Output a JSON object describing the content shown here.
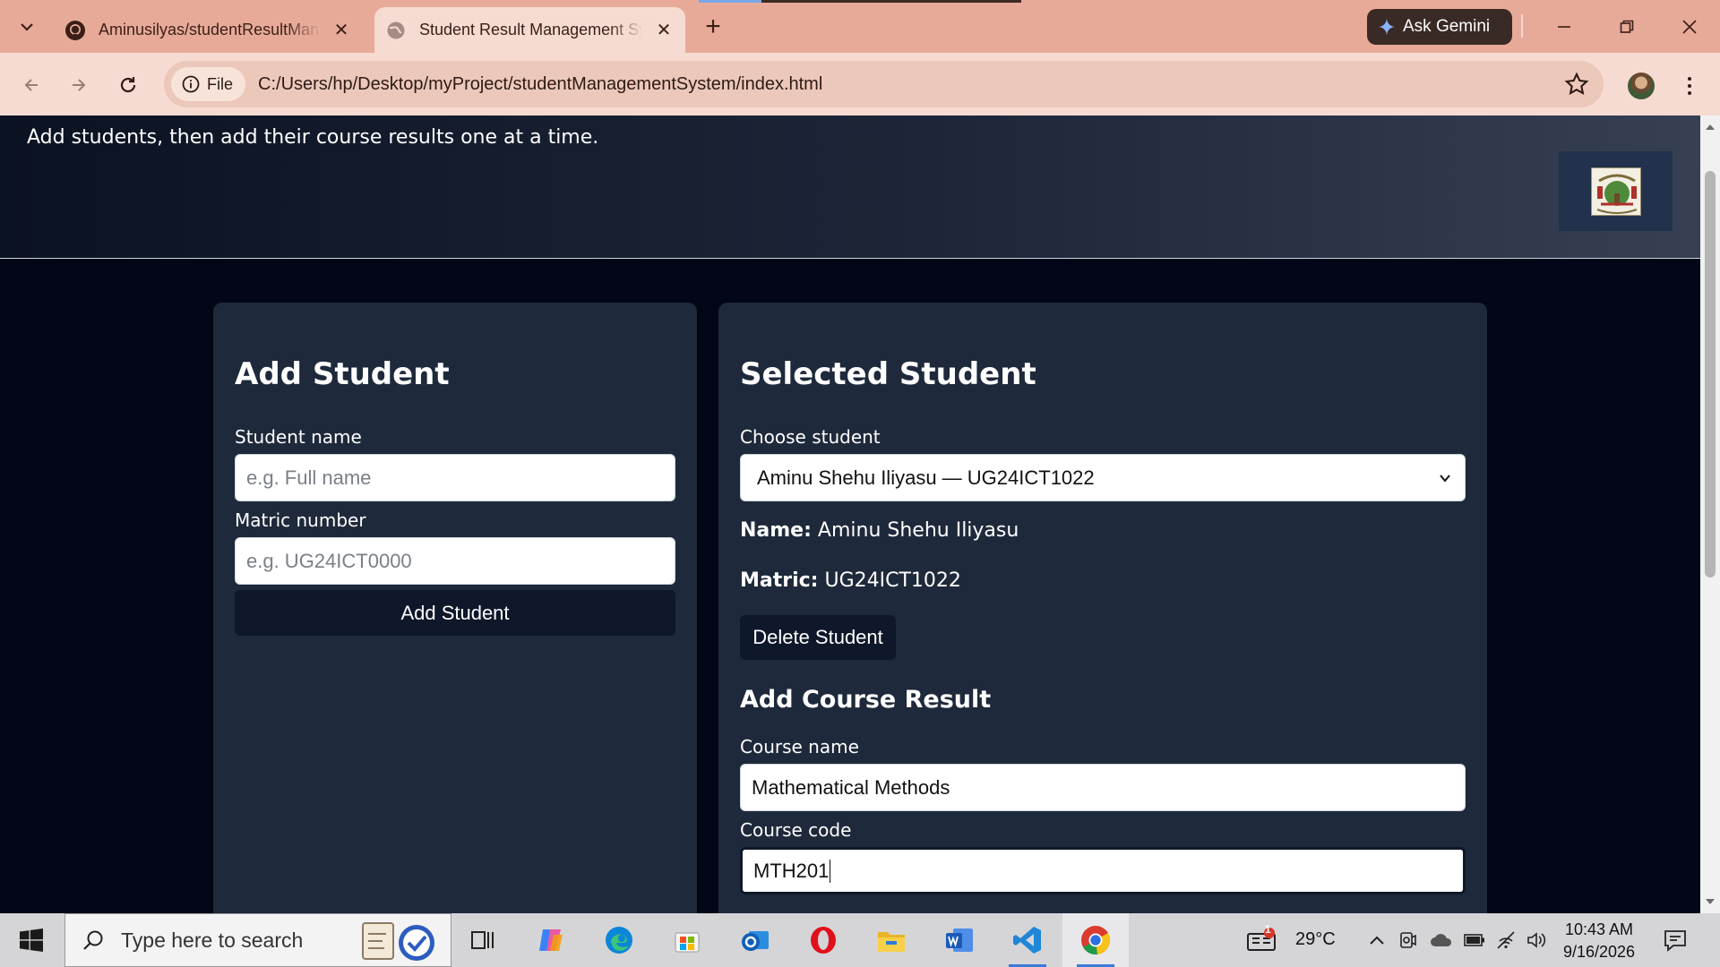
{
  "browser": {
    "tabs": [
      {
        "title": "Aminusilyas/studentResultManagementSystem",
        "icon": "github-icon",
        "active": false
      },
      {
        "title": "Student Result Management System",
        "icon": "globe-icon",
        "active": true
      }
    ],
    "ask_gemini": "Ask Gemini",
    "address": {
      "chip": "File",
      "url": "C:/Users/hp/Desktop/myProject/studentManagementSystem/index.html"
    }
  },
  "page": {
    "subtitle": "Add students, then add their course results one at a time.",
    "add_student": {
      "title": "Add Student",
      "name_label": "Student name",
      "name_placeholder": "e.g. Full name",
      "matric_label": "Matric number",
      "matric_placeholder": "e.g. UG24ICT0000",
      "button": "Add Student"
    },
    "selected_student": {
      "title": "Selected Student",
      "choose_label": "Choose student",
      "selected_option": "Aminu Shehu Iliyasu — UG24ICT1022",
      "name_label": "Name:",
      "name_value": "Aminu Shehu Iliyasu",
      "matric_label": "Matric:",
      "matric_value": "UG24ICT1022",
      "delete_button": "Delete Student",
      "course_heading": "Add Course Result",
      "course_name_label": "Course name",
      "course_name_value": "Mathematical Methods",
      "course_code_label": "Course code",
      "course_code_value": "MTH201"
    }
  },
  "taskbar": {
    "search_placeholder": "Type here to search",
    "weather": "29°C",
    "notification_count": "1",
    "time": "10:43 AM",
    "date": "9/16/2026"
  }
}
